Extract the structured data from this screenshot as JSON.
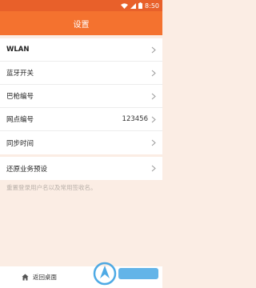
{
  "status_bar": {
    "time": "8:50",
    "icons": [
      "wifi-icon",
      "signal-icon",
      "battery-icon"
    ],
    "background": "#e8602a"
  },
  "app_bar": {
    "title": "设置",
    "background": "#f4722f"
  },
  "settings_group_1": [
    {
      "label": "WLAN",
      "value": ""
    },
    {
      "label": "蓝牙开关",
      "value": ""
    },
    {
      "label": "巴枪编号",
      "value": ""
    },
    {
      "label": "网点编号",
      "value": "123456"
    },
    {
      "label": "同步时间",
      "value": ""
    }
  ],
  "settings_group_2": [
    {
      "label": "还原业务预设",
      "value": ""
    }
  ],
  "hint": "重置登录用户名以及常用签收名。",
  "bottom_bar": {
    "label": "返回桌面",
    "icon": "home-icon"
  },
  "colors": {
    "page_background": "#fbede4",
    "accent": "#f4722f"
  }
}
